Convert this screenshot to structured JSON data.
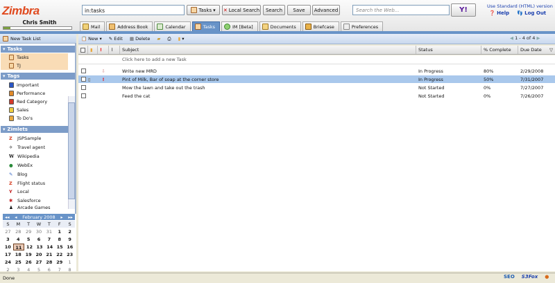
{
  "app": {
    "logo": "Zimbra",
    "user": "Chris Smith",
    "quota_fraction": 0.1
  },
  "search": {
    "value": "in:tasks",
    "type_label": "Tasks",
    "local_label": "Local Search",
    "search_label": "Search",
    "save_label": "Save",
    "advanced_label": "Advanced"
  },
  "web": {
    "placeholder": "Search the Web...",
    "yahoo_label": "Y!"
  },
  "header_links": {
    "standard": "Use Standard (HTML) version",
    "help": "Help",
    "logout": "Log Out"
  },
  "tabs": [
    {
      "label": "Mail"
    },
    {
      "label": "Address Book"
    },
    {
      "label": "Calendar"
    },
    {
      "label": "Tasks"
    },
    {
      "label": "IM [Beta]"
    },
    {
      "label": "Documents"
    },
    {
      "label": "Briefcase"
    },
    {
      "label": "Preferences"
    }
  ],
  "sidebar": {
    "new_list": "New Task List",
    "tasks_header": "Tasks",
    "task_lists": [
      {
        "label": "Tasks"
      },
      {
        "label": "TJ"
      }
    ],
    "tags_header": "Tags",
    "tags": [
      {
        "label": "important",
        "color": "#2a56c6"
      },
      {
        "label": "Performance",
        "color": "#e08a2a"
      },
      {
        "label": "Red Category",
        "color": "#d43a2a"
      },
      {
        "label": "Sales",
        "color": "#f0d040"
      },
      {
        "label": "To Do's",
        "color": "#e9a93e"
      }
    ],
    "zimlets_header": "Zimlets",
    "zimlets": [
      {
        "label": "JSPSample",
        "icon": "zimbra-icon"
      },
      {
        "label": "Travel agent",
        "icon": "plane-icon"
      },
      {
        "label": "Wikipedia",
        "icon": "wikipedia-icon"
      },
      {
        "label": "WebEx",
        "icon": "globe-icon"
      },
      {
        "label": "Blog",
        "icon": "blog-icon"
      },
      {
        "label": "Flight status",
        "icon": "zimbra-icon"
      },
      {
        "label": "Local",
        "icon": "yahoo-icon"
      },
      {
        "label": "Salesforce",
        "icon": "salesforce-icon"
      },
      {
        "label": "Arcade Games",
        "icon": "games-icon"
      }
    ]
  },
  "calendar": {
    "month": "February 2008",
    "dow": [
      "S",
      "M",
      "T",
      "W",
      "T",
      "F",
      "S"
    ],
    "weeks": [
      [
        "27",
        "28",
        "29",
        "30",
        "31",
        "1",
        "2"
      ],
      [
        "3",
        "4",
        "5",
        "6",
        "7",
        "8",
        "9"
      ],
      [
        "10",
        "11",
        "12",
        "13",
        "14",
        "15",
        "16"
      ],
      [
        "17",
        "18",
        "19",
        "20",
        "21",
        "22",
        "23"
      ],
      [
        "24",
        "25",
        "26",
        "27",
        "28",
        "29",
        "1"
      ],
      [
        "2",
        "3",
        "4",
        "5",
        "6",
        "7",
        "8"
      ]
    ]
  },
  "toolbar": {
    "new_label": "New",
    "edit_label": "Edit",
    "delete_label": "Delete",
    "pager": "1 - 4 of 4"
  },
  "list": {
    "headers": {
      "subject": "Subject",
      "status": "Status",
      "complete": "% Complete",
      "due": "Due Date"
    },
    "add_prompt": "Click here to add a new Task",
    "rows": [
      {
        "subject": "Write new MRD",
        "status": "In Progress",
        "complete": "80%",
        "due": "2/29/2008",
        "priority": "low"
      },
      {
        "subject": "Pint of Milk, Bar of soap at the corner store",
        "status": "In Progress",
        "complete": "50%",
        "due": "7/31/2007",
        "priority": "high"
      },
      {
        "subject": "Mow the lawn and take out the trash",
        "status": "Not Started",
        "complete": "0%",
        "due": "7/27/2007",
        "priority": ""
      },
      {
        "subject": "Feed the cat",
        "status": "Not Started",
        "complete": "0%",
        "due": "7/26/2007",
        "priority": ""
      }
    ]
  },
  "statusbar": {
    "text": "Done",
    "seo": "SEO",
    "s3fox": "S3Fox"
  }
}
